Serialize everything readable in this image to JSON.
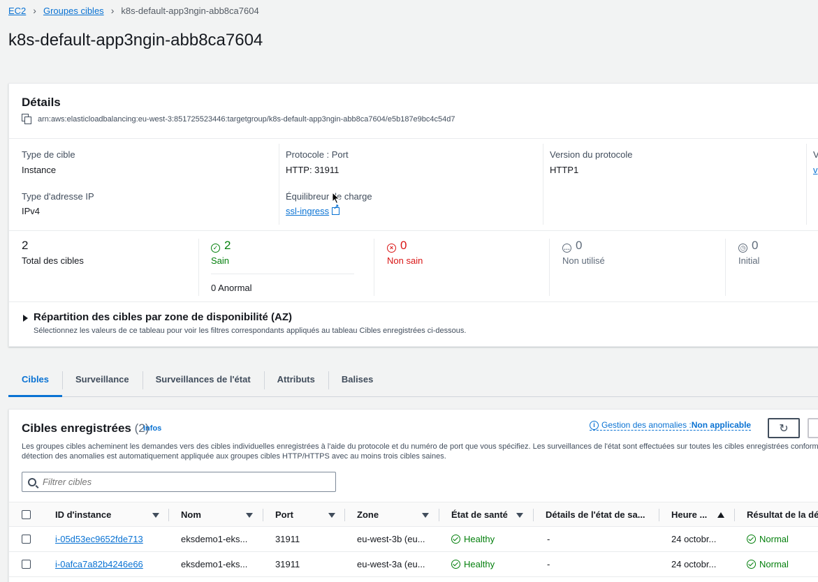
{
  "breadcrumb": {
    "item1": "EC2",
    "item2": "Groupes cibles",
    "current": "k8s-default-app3ngin-abb8ca7604"
  },
  "page_title": "k8s-default-app3ngin-abb8ca7604",
  "details": {
    "title": "Détails",
    "arn": "arn:aws:elasticloadbalancing:eu-west-3:851725523446:targetgroup/k8s-default-app3ngin-abb8ca7604/e5b187e9bc4c54d7",
    "target_type_label": "Type de cible",
    "target_type_value": "Instance",
    "protocol_label": "Protocole : Port",
    "protocol_value": "HTTP: 31911",
    "protocol_version_label": "Version du protocole",
    "protocol_version_value": "HTTP1",
    "col4_label": "V",
    "col4_value": "v",
    "ip_type_label": "Type d'adresse IP",
    "ip_type_value": "IPv4",
    "lb_label": "Équilibreur de charge",
    "lb_value": "ssl-ingress"
  },
  "stats": {
    "total_value": "2",
    "total_label": "Total des cibles",
    "healthy_value": "2",
    "healthy_label": "Sain",
    "anomalous": "0 Anormal",
    "unhealthy_value": "0",
    "unhealthy_label": "Non sain",
    "unused_value": "0",
    "unused_label": "Non utilisé",
    "initial_value": "0",
    "initial_label": "Initial"
  },
  "az": {
    "title": "Répartition des cibles par zone de disponibilité (AZ)",
    "description": "Sélectionnez les valeurs de ce tableau pour voir les filtres correspondants appliqués au tableau Cibles enregistrées ci-dessous."
  },
  "tabs": [
    "Cibles",
    "Surveillance",
    "Surveillances de l'état",
    "Attributs",
    "Balises"
  ],
  "targets": {
    "title": "Cibles enregistrées",
    "count": "(2)",
    "infos": "Infos",
    "anomaly_label": "Gestion des anomalies : ",
    "anomaly_value": "Non applicable",
    "desc_line1": "Les groupes cibles acheminent les demandes vers des cibles individuelles enregistrées à l'aide du protocole et du numéro de port que vous spécifiez. Les surveillances de l'état sont effectuées sur toutes les cibles enregistrées conformém",
    "desc_line2": "détection des anomalies est automatiquement appliquée aux groupes cibles HTTP/HTTPS avec au moins trois cibles saines.",
    "filter_placeholder": "Filtrer cibles",
    "columns": {
      "instance_id": "ID d'instance",
      "name": "Nom",
      "port": "Port",
      "zone": "Zone",
      "health": "État de santé",
      "health_details": "Détails de l'état de sa...",
      "time": "Heure ...",
      "result": "Résultat de la dét"
    },
    "rows": [
      {
        "instance_id": "i-05d53ec9652fde713",
        "name": "eksdemo1-eks...",
        "port": "31911",
        "zone": "eu-west-3b (eu...",
        "health": "Healthy",
        "details": "-",
        "time": "24 octobr...",
        "result": "Normal"
      },
      {
        "instance_id": "i-0afca7a82b4246e66",
        "name": "eksdemo1-eks...",
        "port": "31911",
        "zone": "eu-west-3a (eu...",
        "health": "Healthy",
        "details": "-",
        "time": "24 octobr...",
        "result": "Normal"
      }
    ]
  }
}
